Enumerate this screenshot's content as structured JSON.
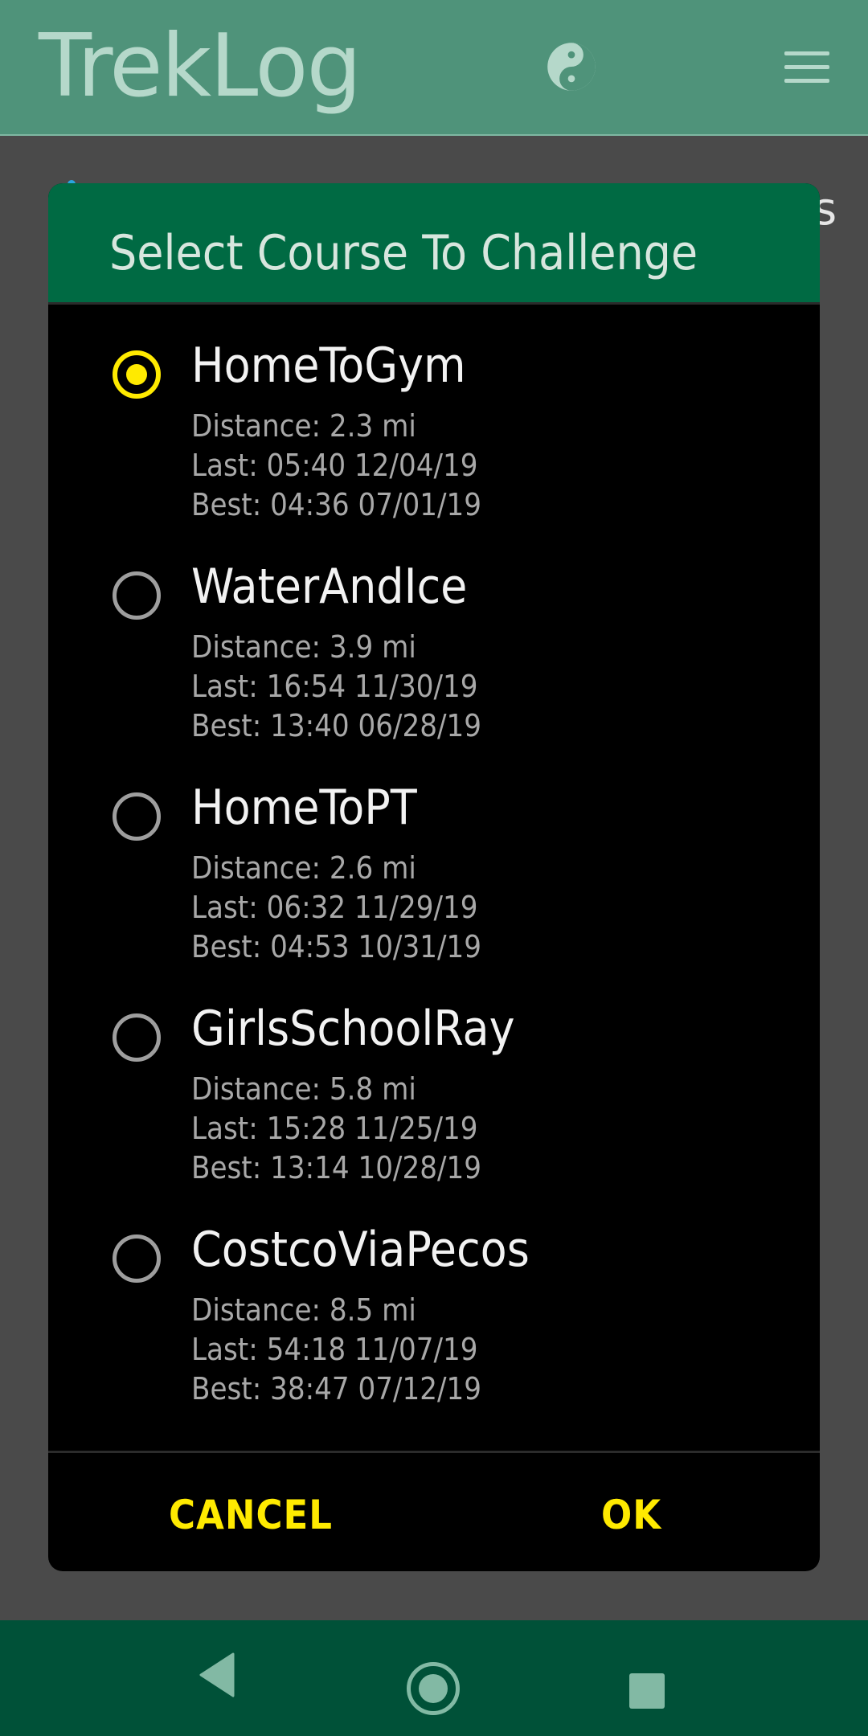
{
  "app": {
    "title": "TrekLog",
    "theme_icon": "yin-yang-icon",
    "menu_icon": "hamburger-menu-icon"
  },
  "background": {
    "partial_text": "s"
  },
  "dialog": {
    "title": "Select Course To Challenge",
    "selected_index": 0,
    "courses": [
      {
        "name": "HomeToGym",
        "distance": "Distance: 2.3 mi",
        "last": "Last: 05:40 12/04/19",
        "best": "Best: 04:36 07/01/19"
      },
      {
        "name": "WaterAndIce",
        "distance": "Distance: 3.9 mi",
        "last": "Last: 16:54 11/30/19",
        "best": "Best: 13:40 06/28/19"
      },
      {
        "name": "HomeToPT",
        "distance": "Distance: 2.6 mi",
        "last": "Last: 06:32 11/29/19",
        "best": "Best: 04:53 10/31/19"
      },
      {
        "name": "GirlsSchoolRay",
        "distance": "Distance: 5.8 mi",
        "last": "Last: 15:28 11/25/19",
        "best": "Best: 13:14 10/28/19"
      },
      {
        "name": "CostcoViaPecos",
        "distance": "Distance: 8.5 mi",
        "last": "Last: 54:18 11/07/19",
        "best": "Best: 38:47 07/12/19"
      }
    ],
    "cancel_label": "CANCEL",
    "ok_label": "OK"
  },
  "colors": {
    "header": "#4f937a",
    "dialog_header": "#006a43",
    "accent": "#ffea00",
    "navbar": "#005138"
  },
  "navbar": {
    "back_icon": "back-triangle-icon",
    "home_icon": "home-circle-icon",
    "recents_icon": "recents-square-icon"
  }
}
